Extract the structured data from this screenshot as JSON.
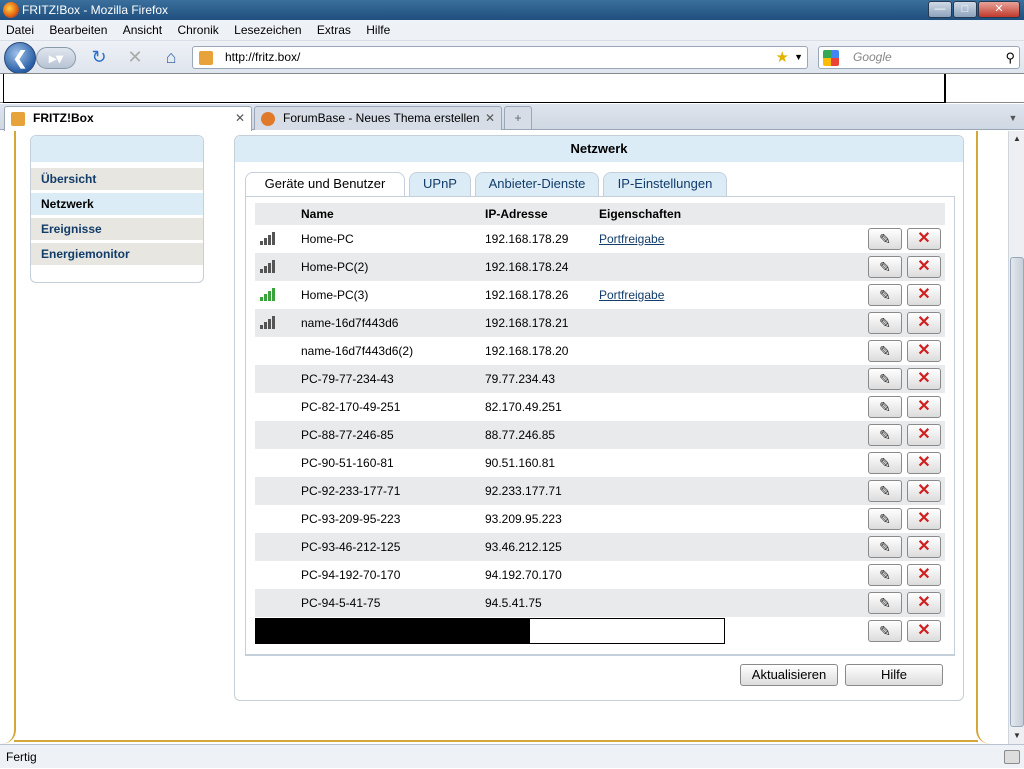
{
  "window": {
    "title": "FRITZ!Box - Mozilla Firefox"
  },
  "menu": [
    "Datei",
    "Bearbeiten",
    "Ansicht",
    "Chronik",
    "Lesezeichen",
    "Extras",
    "Hilfe"
  ],
  "address": {
    "url": "http://fritz.box/"
  },
  "search": {
    "placeholder": "Google"
  },
  "tabs": [
    {
      "label": "FRITZ!Box"
    },
    {
      "label": "ForumBase - Neues Thema erstellen"
    }
  ],
  "sidebar": {
    "items": [
      {
        "label": "Übersicht"
      },
      {
        "label": "Netzwerk"
      },
      {
        "label": "Ereignisse"
      },
      {
        "label": "Energiemonitor"
      }
    ]
  },
  "panel": {
    "title": "Netzwerk",
    "tabs": [
      {
        "label": "Geräte und Benutzer"
      },
      {
        "label": "UPnP"
      },
      {
        "label": "Anbieter-Dienste"
      },
      {
        "label": "IP-Einstellungen"
      }
    ],
    "columns": {
      "name": "Name",
      "ip": "IP-Adresse",
      "props": "Eigenschaften"
    },
    "rows": [
      {
        "name": "Home-PC",
        "ip": "192.168.178.29",
        "prop": "Portfreigabe",
        "icon": "signal-icon"
      },
      {
        "name": "Home-PC(2)",
        "ip": "192.168.178.24",
        "prop": "",
        "icon": "signal-icon"
      },
      {
        "name": "Home-PC(3)",
        "ip": "192.168.178.26",
        "prop": "Portfreigabe",
        "icon": "signal-green-icon"
      },
      {
        "name": "name-16d7f443d6",
        "ip": "192.168.178.21",
        "prop": "",
        "icon": "signal-icon"
      },
      {
        "name": "name-16d7f443d6(2)",
        "ip": "192.168.178.20",
        "prop": "",
        "icon": ""
      },
      {
        "name": "PC-79-77-234-43",
        "ip": "79.77.234.43",
        "prop": "",
        "icon": ""
      },
      {
        "name": "PC-82-170-49-251",
        "ip": "82.170.49.251",
        "prop": "",
        "icon": ""
      },
      {
        "name": "PC-88-77-246-85",
        "ip": "88.77.246.85",
        "prop": "",
        "icon": ""
      },
      {
        "name": "PC-90-51-160-81",
        "ip": "90.51.160.81",
        "prop": "",
        "icon": ""
      },
      {
        "name": "PC-92-233-177-71",
        "ip": "92.233.177.71",
        "prop": "",
        "icon": ""
      },
      {
        "name": "PC-93-209-95-223",
        "ip": "93.209.95.223",
        "prop": "",
        "icon": ""
      },
      {
        "name": "PC-93-46-212-125",
        "ip": "93.46.212.125",
        "prop": "",
        "icon": ""
      },
      {
        "name": "PC-94-192-70-170",
        "ip": "94.192.70.170",
        "prop": "",
        "icon": ""
      },
      {
        "name": "PC-94-5-41-75",
        "ip": "94.5.41.75",
        "prop": "",
        "icon": ""
      }
    ],
    "buttons": {
      "refresh": "Aktualisieren",
      "help": "Hilfe"
    }
  },
  "status": {
    "text": "Fertig"
  }
}
